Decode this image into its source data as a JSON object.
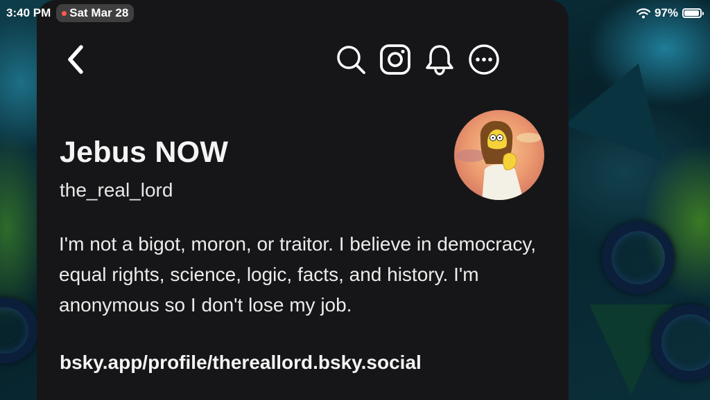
{
  "status_bar": {
    "time": "3:40 PM",
    "date": "Sat Mar 28",
    "battery_percent": "97%",
    "battery_level": 0.97,
    "icons": [
      "wifi-icon",
      "battery-icon"
    ]
  },
  "toolbar": {
    "back_icon": "chevron-left-icon",
    "icons": [
      "search-icon",
      "instagram-icon",
      "bell-icon",
      "more-icon"
    ]
  },
  "profile": {
    "display_name": "Jebus NOW",
    "handle": "the_real_lord",
    "bio": "I'm not a bigot, moron, or traitor. I believe in democracy, equal rights, science, logic, facts, and history. I'm anonymous so I don't lose my job.",
    "link": "bsky.app/profile/thereallord.bsky.social",
    "avatar_icon": "avatar"
  },
  "colors": {
    "panel_bg": "#161618",
    "text": "#f4f4f4",
    "recording_dot": "#ff5a4e"
  }
}
